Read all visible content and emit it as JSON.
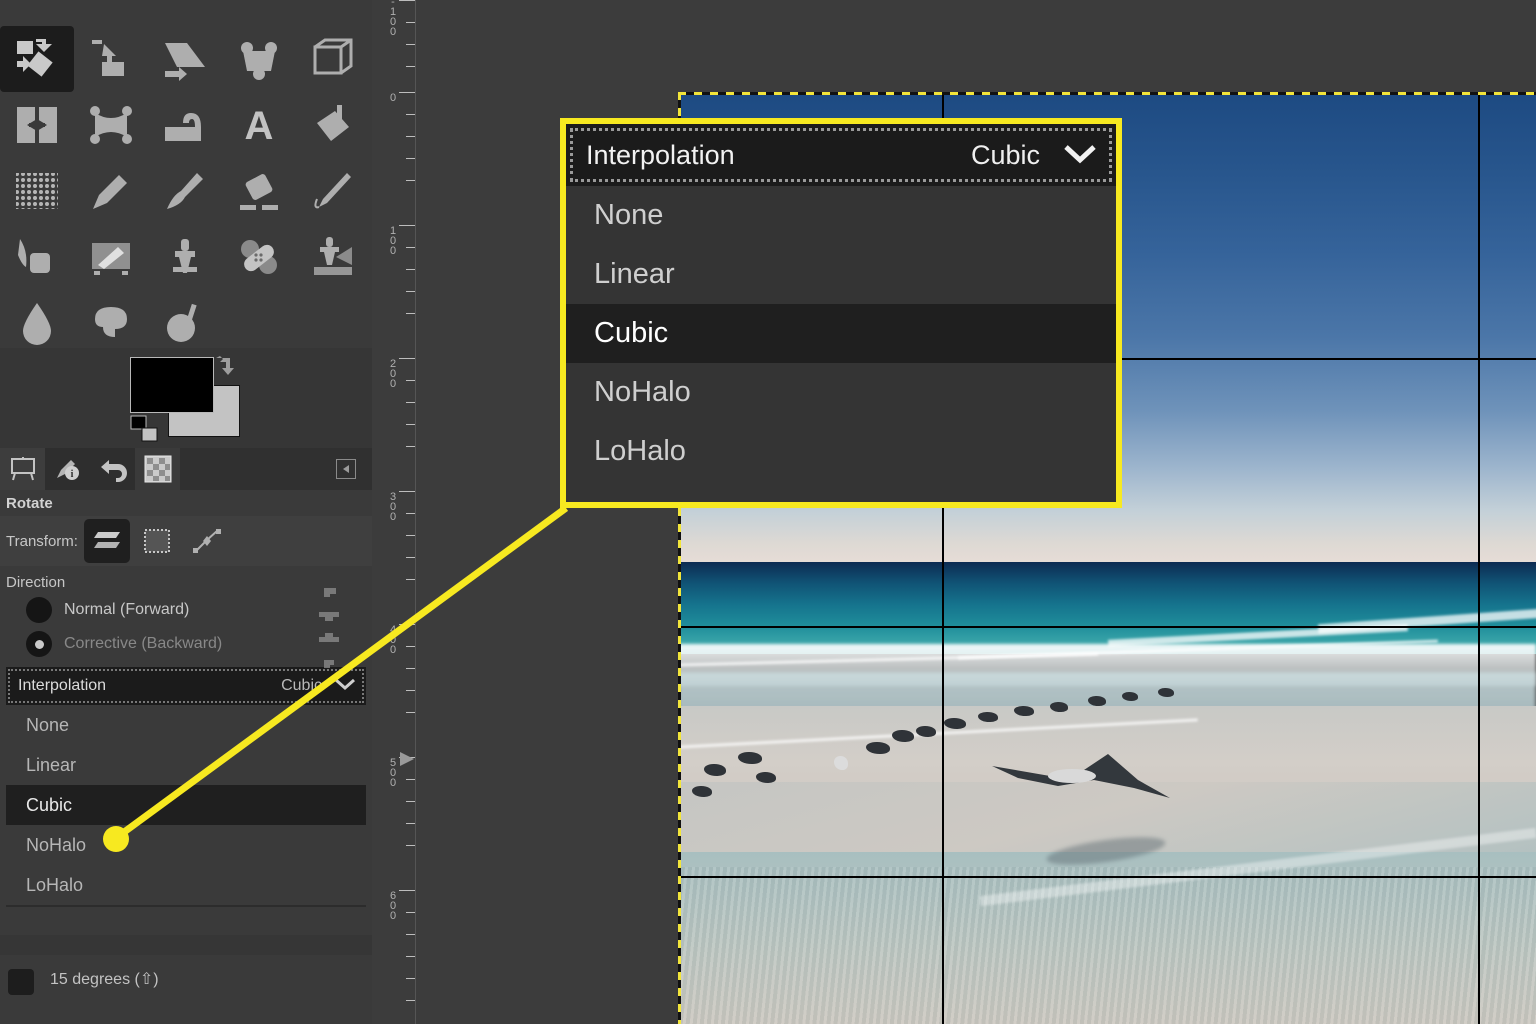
{
  "app": {
    "name": "GIMP",
    "theme_bg": "#363636",
    "accent_yellow": "#f7e920"
  },
  "toolbox": {
    "name": "toolbox",
    "rows": [
      [
        {
          "icon": "align-tool-icon",
          "label": "Align",
          "selected": false
        },
        {
          "icon": "move-tool-icon",
          "label": "Move",
          "selected": false
        },
        {
          "icon": "crop-tool-icon",
          "label": "Crop",
          "selected": false
        },
        {
          "icon": "scale-tool-icon",
          "label": "Scale",
          "selected": false
        },
        {
          "icon": "shear-tool-icon",
          "label": "Shear",
          "selected": false
        }
      ],
      [
        {
          "icon": "rotate-tool-icon",
          "label": "Rotate",
          "selected": true
        },
        {
          "icon": "unified-transform-icon",
          "label": "Unified Transform",
          "selected": false
        },
        {
          "icon": "perspective-tool-icon",
          "label": "Perspective",
          "selected": false
        },
        {
          "icon": "handle-transform-icon",
          "label": "Handle Transform",
          "selected": false
        },
        {
          "icon": "3d-transform-icon",
          "label": "3D Transform",
          "selected": false
        }
      ],
      [
        {
          "icon": "flip-tool-icon",
          "label": "Flip",
          "selected": false
        },
        {
          "icon": "cage-transform-icon",
          "label": "Cage Transform",
          "selected": false
        },
        {
          "icon": "warp-transform-icon",
          "label": "Warp Transform",
          "selected": false
        },
        {
          "icon": "text-tool-icon",
          "label": "Text",
          "selected": false
        },
        {
          "icon": "bucket-fill-icon",
          "label": "Bucket Fill",
          "selected": false
        }
      ],
      [
        {
          "icon": "gradient-tool-icon",
          "label": "Gradient",
          "selected": false
        },
        {
          "icon": "pencil-tool-icon",
          "label": "Pencil",
          "selected": false
        },
        {
          "icon": "paintbrush-tool-icon",
          "label": "Paintbrush",
          "selected": false
        },
        {
          "icon": "eraser-tool-icon",
          "label": "Eraser",
          "selected": false
        },
        {
          "icon": "ink-tool-icon",
          "label": "Ink",
          "selected": false
        }
      ],
      [
        {
          "icon": "mypaint-brush-icon",
          "label": "MyPaint Brush",
          "selected": false
        },
        {
          "icon": "clone-source-icon",
          "label": "Clone",
          "selected": false
        },
        {
          "icon": "clone-tool-icon",
          "label": "Clone Stamp",
          "selected": false
        },
        {
          "icon": "heal-tool-icon",
          "label": "Heal",
          "selected": false
        },
        {
          "icon": "perspective-clone-icon",
          "label": "Perspective Clone",
          "selected": false
        }
      ],
      [
        {
          "icon": "blur-sharpen-icon",
          "label": "Blur / Sharpen",
          "selected": false
        },
        {
          "icon": "smudge-tool-icon",
          "label": "Smudge",
          "selected": false
        },
        {
          "icon": "dodge-burn-icon",
          "label": "Dodge / Burn",
          "selected": false
        }
      ]
    ]
  },
  "swatches": {
    "foreground_color": "#000000",
    "background_color": "#c3c3c3",
    "swap_icon": "swap-colors-icon",
    "default_icon": "default-colors-icon"
  },
  "dock_tabs": [
    {
      "icon": "tool-options-icon",
      "label": "Tool Options",
      "active": true
    },
    {
      "icon": "device-status-icon",
      "label": "Device Status",
      "active": false
    },
    {
      "icon": "undo-history-icon",
      "label": "Undo History",
      "active": false
    },
    {
      "icon": "pattern-icon",
      "label": "Patterns",
      "active": false
    }
  ],
  "dock_menu_icon": "dock-menu-icon",
  "tool_options": {
    "title": "Rotate",
    "transform": {
      "label": "Transform:",
      "buttons": [
        {
          "icon": "transform-layer-icon",
          "label": "Layer",
          "selected": true
        },
        {
          "icon": "transform-selection-icon",
          "label": "Selection",
          "selected": false
        },
        {
          "icon": "transform-path-icon",
          "label": "Path",
          "selected": false
        }
      ]
    },
    "direction": {
      "label": "Direction",
      "options": [
        {
          "label": "Normal (Forward)",
          "selected": true,
          "enabled": true
        },
        {
          "label": "Corrective (Backward)",
          "selected": false,
          "enabled": false
        }
      ]
    },
    "interpolation": {
      "label": "Interpolation",
      "value": "Cubic",
      "chevron_icon": "chevron-down-icon",
      "expanded": true,
      "options": [
        {
          "label": "None",
          "selected": false
        },
        {
          "label": "Linear",
          "selected": false
        },
        {
          "label": "Cubic",
          "selected": true
        },
        {
          "label": "NoHalo",
          "selected": false
        },
        {
          "label": "LoHalo",
          "selected": false
        }
      ]
    },
    "constrain_row": {
      "label": "15 degrees (⇧)",
      "checked": false
    },
    "scroll_glyph_icon": "scroll-handles-icon"
  },
  "callout": {
    "name": "magnified-interpolation-dropdown",
    "border_color": "#f7e920",
    "combo": {
      "label": "Interpolation",
      "value": "Cubic",
      "chevron_icon": "chevron-down-icon"
    },
    "options": [
      {
        "label": "None",
        "selected": false
      },
      {
        "label": "Linear",
        "selected": false
      },
      {
        "label": "Cubic",
        "selected": true
      },
      {
        "label": "NoHalo",
        "selected": false
      },
      {
        "label": "LoHalo",
        "selected": false
      }
    ],
    "leader_line": {
      "color": "#f7e920",
      "target": "Cubic"
    }
  },
  "canvas": {
    "name": "image-canvas",
    "ruler": {
      "orientation": "vertical",
      "unit_labels": [
        "-100",
        "0",
        "100",
        "200",
        "300",
        "400",
        "500",
        "600"
      ],
      "marker_value": "500"
    },
    "selection": {
      "style": "dashed-yellow-black",
      "visible": true
    },
    "transform_grid": {
      "visible": true,
      "vertical_lines": 2,
      "horizontal_lines": 3
    },
    "image_description": "Beach photograph: deep blue sky gradient over turquoise ocean, breaking surf, wet sand with a flock of shorebirds, one gull in flight"
  }
}
